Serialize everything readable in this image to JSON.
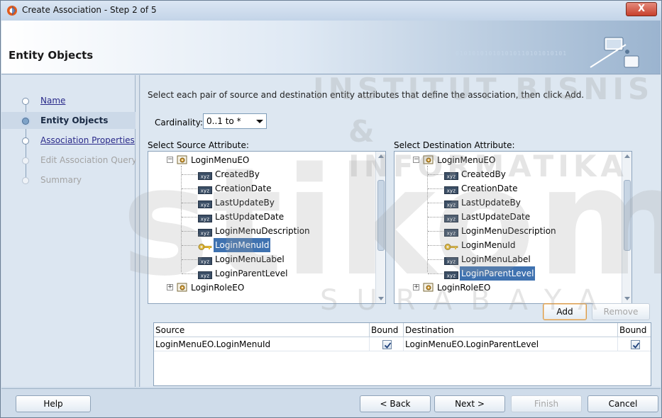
{
  "window": {
    "title": "Create Association - Step 2 of 5",
    "close_symbol": "X",
    "app_icon": "oracle-jdev-icon"
  },
  "banner": {
    "heading": "Entity Objects",
    "binary_text": "010101010101010110101010101"
  },
  "nav": {
    "items": [
      {
        "label": "Name",
        "state": "link"
      },
      {
        "label": "Entity Objects",
        "state": "current"
      },
      {
        "label": "Association Properties",
        "state": "link"
      },
      {
        "label": "Edit Association Query",
        "state": "disabled"
      },
      {
        "label": "Summary",
        "state": "disabled"
      }
    ]
  },
  "main": {
    "instructions": "Select each pair of source and destination entity attributes that define the association, then click Add.",
    "cardinality_label": "Cardinality:",
    "cardinality_value": "0..1 to *",
    "source_title": "Select Source Attribute:",
    "destination_title": "Select Destination Attribute:",
    "source_tree": {
      "root": "LoginMenuEO",
      "attributes": [
        "CreatedBy",
        "CreationDate",
        "LastUpdateBy",
        "LastUpdateDate",
        "LoginMenuDescription",
        "LoginMenuId",
        "LoginMenuLabel",
        "LoginParentLevel"
      ],
      "key_attribute": "LoginMenuId",
      "selected": "LoginMenuId",
      "next_node": "LoginRoleEO"
    },
    "destination_tree": {
      "root": "LoginMenuEO",
      "attributes": [
        "CreatedBy",
        "CreationDate",
        "LastUpdateBy",
        "LastUpdateDate",
        "LoginMenuDescription",
        "LoginMenuId",
        "LoginMenuLabel",
        "LoginParentLevel"
      ],
      "key_attribute": "LoginMenuId",
      "selected": "LoginParentLevel",
      "next_node": "LoginRoleEO"
    },
    "attr_badge": "xyz",
    "add_label": "Add",
    "remove_label": "Remove",
    "table": {
      "columns": [
        "Source",
        "Bound",
        "Destination",
        "Bound"
      ],
      "rows": [
        {
          "source": "LoginMenuEO.LoginMenuId",
          "source_bound": true,
          "destination": "LoginMenuEO.LoginParentLevel",
          "destination_bound": true
        }
      ]
    }
  },
  "footer": {
    "help_label": "Help",
    "back_label": "< Back",
    "next_label": "Next >",
    "finish_label": "Finish",
    "cancel_label": "Cancel"
  },
  "watermark": {
    "line1": "INSTITUT BISNIS",
    "line2": "& INFORMATIKA",
    "line3": "stikom",
    "line4": "SURABAYA"
  },
  "colors": {
    "accent": "#3f72b0",
    "window_bg": "#cfdcea",
    "panel_bg": "#dde7f1"
  }
}
